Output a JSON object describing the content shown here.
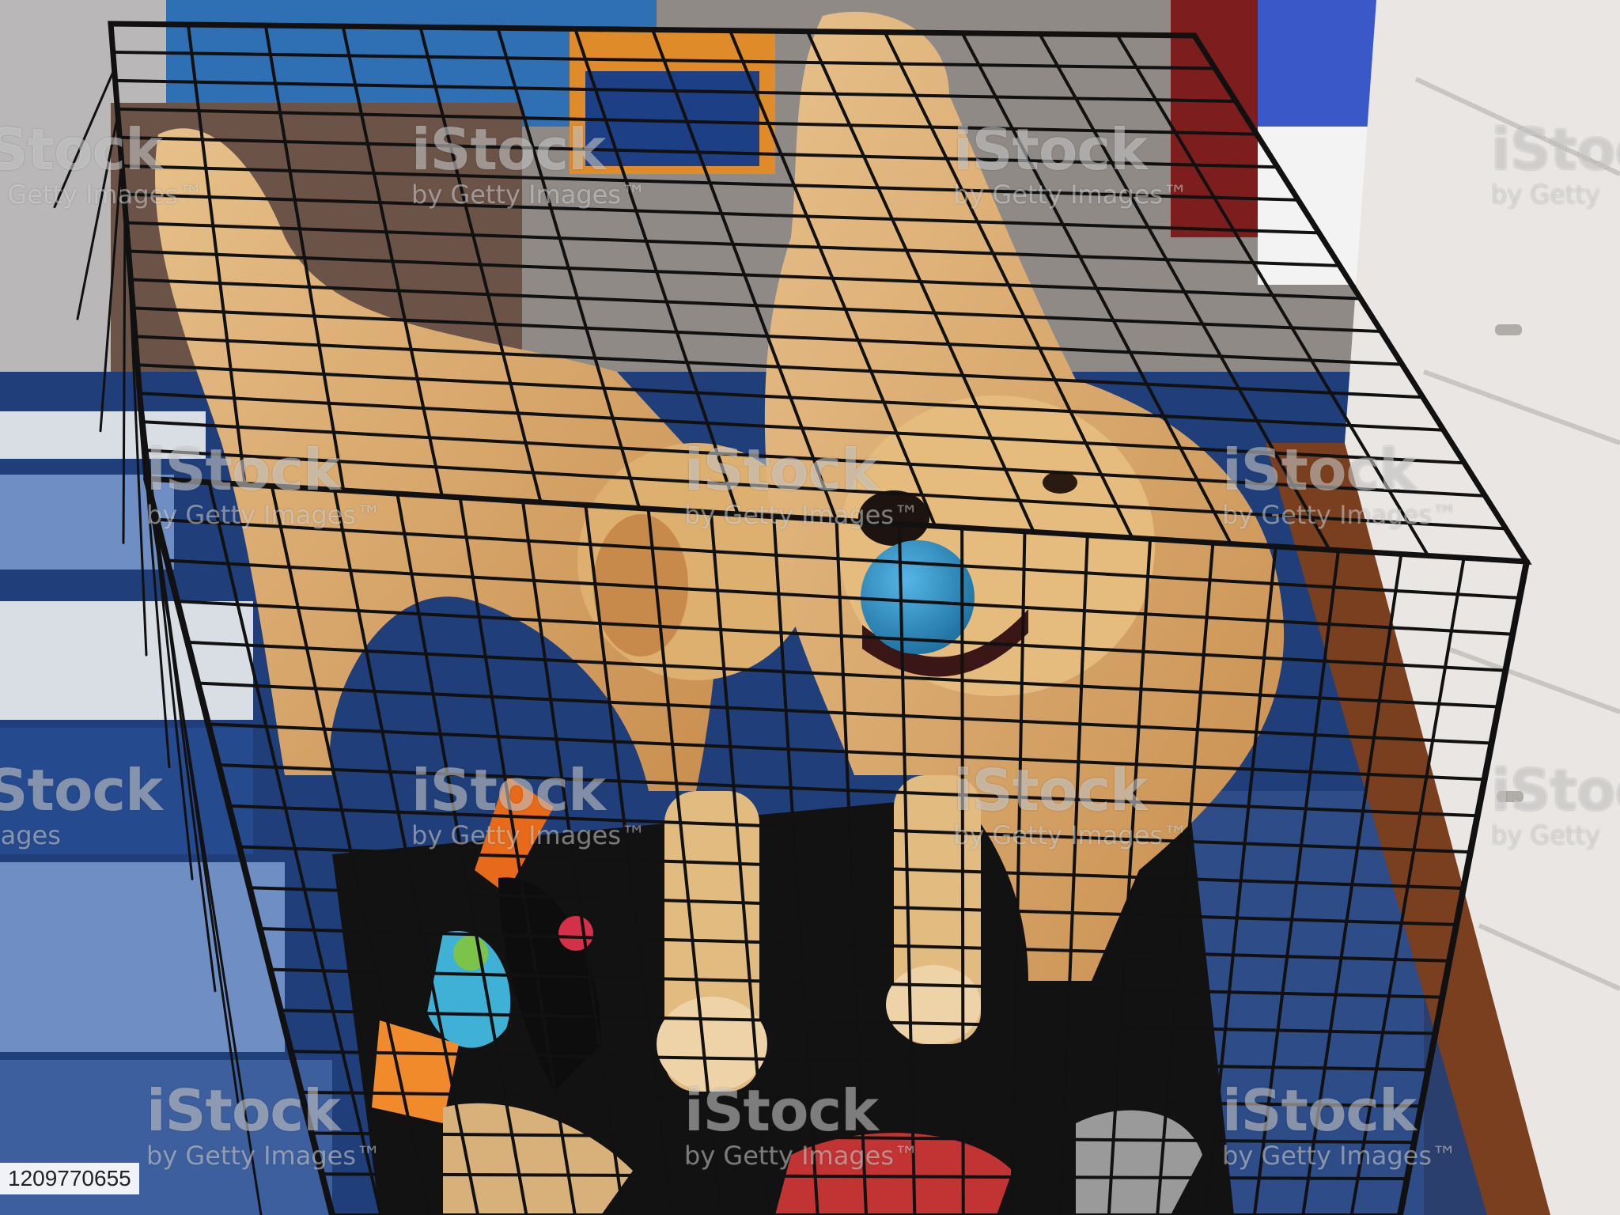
{
  "photo": {
    "subject": "two-golden-retrievers-in-wire-crate",
    "ball_color": "#2f8fc9",
    "dog_color": "#d9a866",
    "rug_colors": [
      "#1f3e7a",
      "#d9dde4",
      "#6f8fc4"
    ]
  },
  "watermark": {
    "logo_text": "iStock",
    "sub_text": "by Getty Images",
    "sub_text_short": "by Getty",
    "sub_text_left": "Images",
    "tm": "™"
  },
  "image_id": "1209770655"
}
